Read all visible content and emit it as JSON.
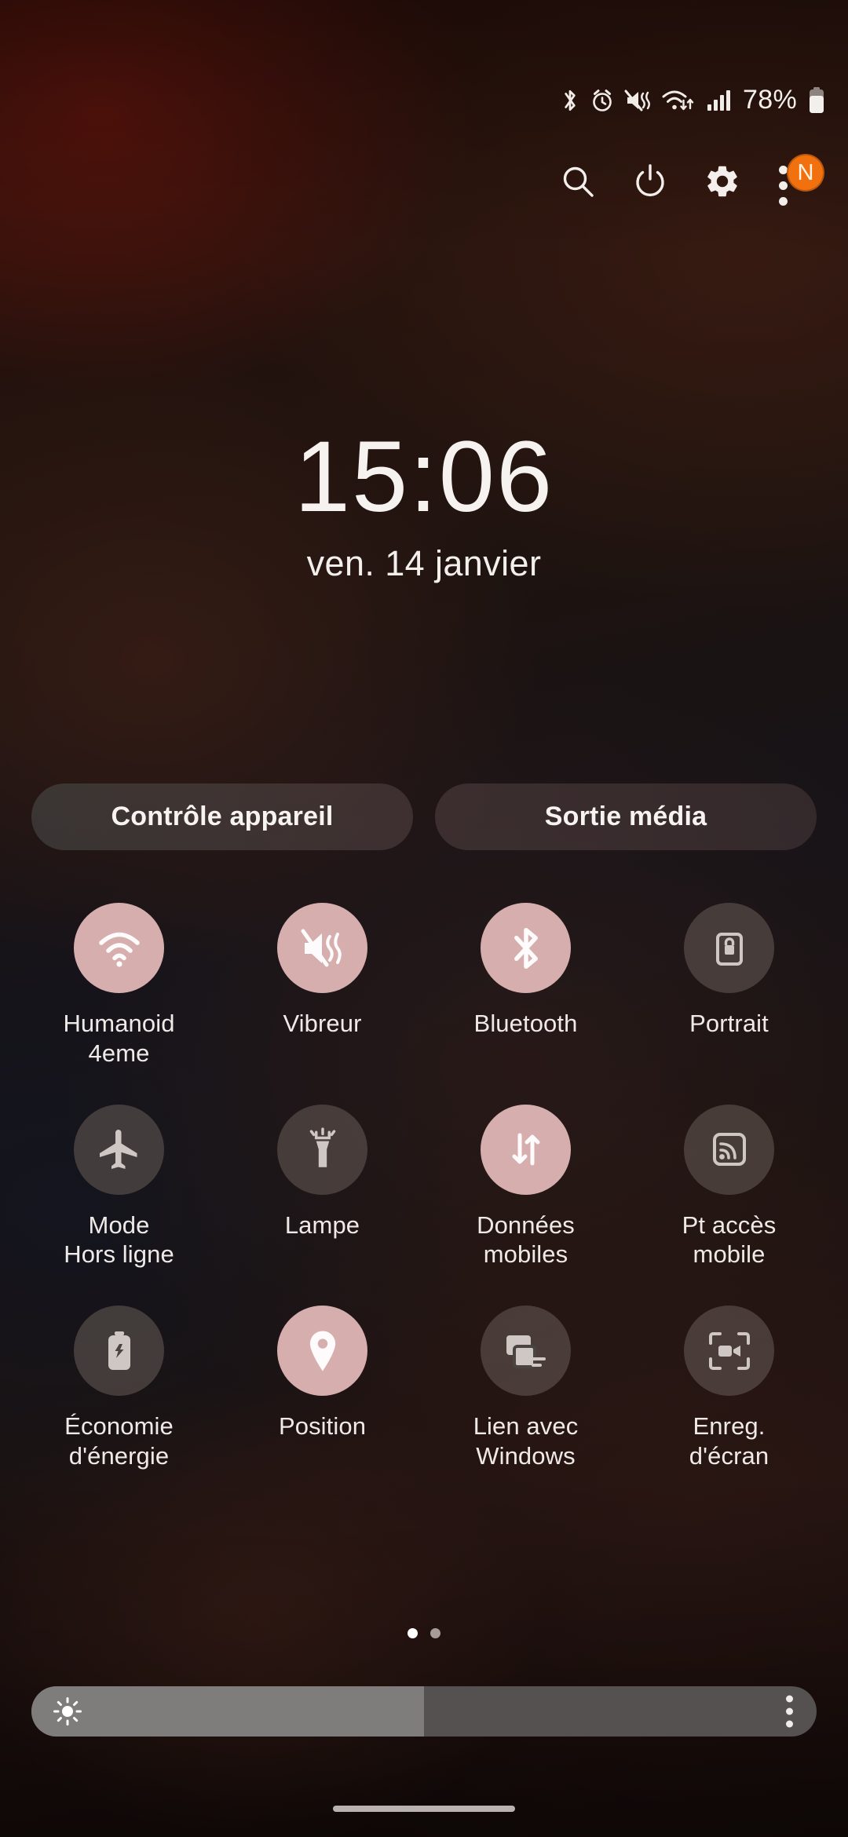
{
  "statusbar": {
    "icons": [
      "bluetooth-icon",
      "alarm-icon",
      "vibrate-icon",
      "wifi-data-icon",
      "signal-bars-icon"
    ],
    "battery_percent": "78%",
    "battery_icon": "battery-icon"
  },
  "header": {
    "search_icon": "search-icon",
    "power_icon": "power-icon",
    "settings_icon": "gear-icon",
    "overflow_icon": "kebab-menu-icon",
    "avatar_initial": "N",
    "avatar_color": "#f2710f"
  },
  "clock": {
    "time": "15:06",
    "date": "ven. 14 janvier"
  },
  "pills": [
    {
      "label": "Contrôle appareil"
    },
    {
      "label": "Sortie média"
    }
  ],
  "tiles": [
    {
      "label": "Humanoid\n4eme",
      "icon": "wifi-icon",
      "state": "on"
    },
    {
      "label": "Vibreur",
      "icon": "vibrate-mute-icon",
      "state": "on"
    },
    {
      "label": "Bluetooth",
      "icon": "bluetooth-icon",
      "state": "on"
    },
    {
      "label": "Portrait",
      "icon": "rotation-lock-icon",
      "state": "off"
    },
    {
      "label": "Mode\nHors ligne",
      "icon": "airplane-icon",
      "state": "off"
    },
    {
      "label": "Lampe",
      "icon": "flashlight-icon",
      "state": "off"
    },
    {
      "label": "Données\nmobiles",
      "icon": "mobile-data-icon",
      "state": "on"
    },
    {
      "label": "Pt accès\nmobile",
      "icon": "hotspot-icon",
      "state": "off"
    },
    {
      "label": "Économie\nd'énergie",
      "icon": "battery-saver-icon",
      "state": "off"
    },
    {
      "label": "Position",
      "icon": "location-pin-icon",
      "state": "on"
    },
    {
      "label": "Lien avec\nWindows",
      "icon": "link-to-windows-icon",
      "state": "off"
    },
    {
      "label": "Enreg.\nd'écran",
      "icon": "screen-record-icon",
      "state": "off"
    }
  ],
  "pagination": {
    "total": 2,
    "active": 1
  },
  "brightness": {
    "value_percent": 50,
    "icon": "brightness-sun-icon",
    "overflow_icon": "kebab-menu-icon"
  },
  "colors": {
    "tile_on": "#d7aeae",
    "tile_off": "rgba(104,92,88,.55)",
    "accent_avatar": "#f2710f",
    "text": "#f1ece9"
  }
}
